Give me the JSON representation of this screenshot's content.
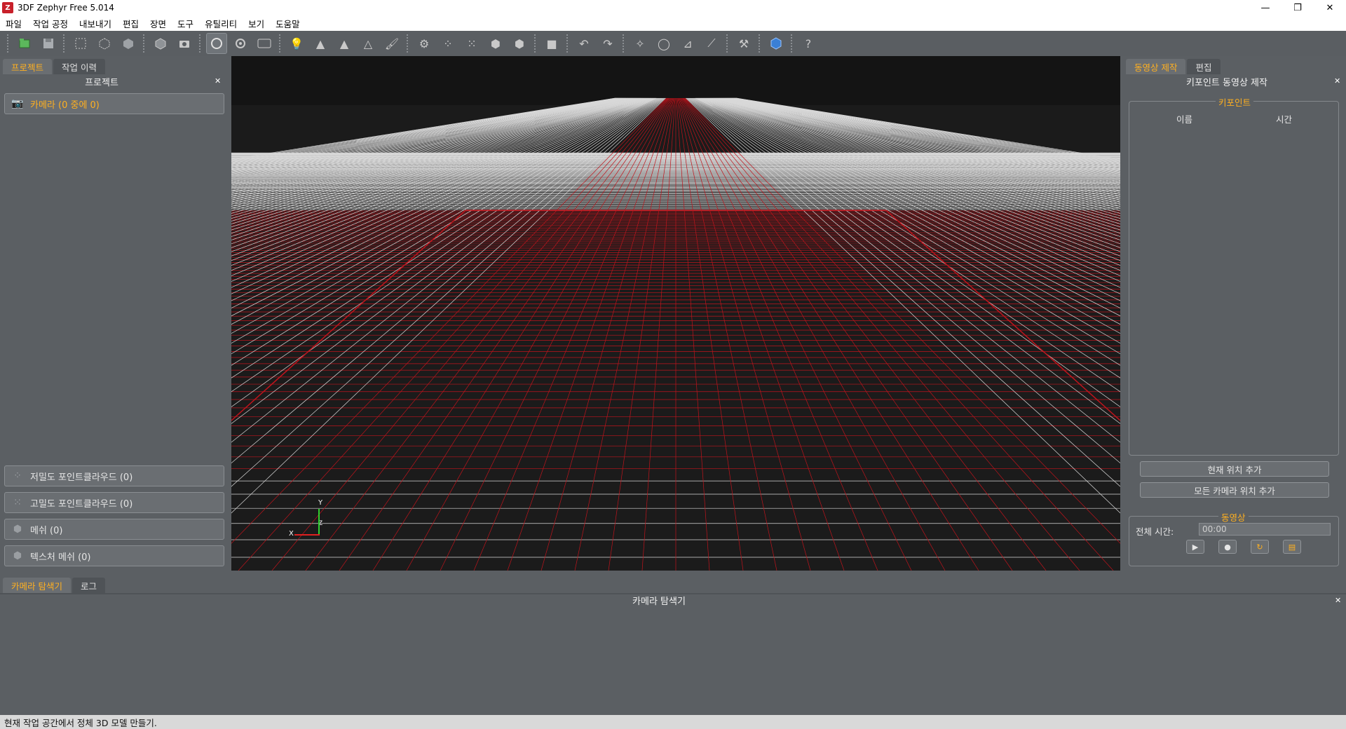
{
  "window": {
    "title": "3DF Zephyr Free 5.014",
    "minimize": "—",
    "restore": "❐",
    "close": "✕"
  },
  "menu": [
    "파일",
    "작업 공정",
    "내보내기",
    "편집",
    "장면",
    "도구",
    "유틸리티",
    "보기",
    "도움말"
  ],
  "left": {
    "tabs": [
      "프로젝트",
      "작업 이력"
    ],
    "panel_title": "프로젝트",
    "cameras": "카메라 (0 중에 0)",
    "sparse": "저밀도 포인트클라우드 (0)",
    "dense": "고밀도 포인트클라우드 (0)",
    "mesh": "메쉬 (0)",
    "textured": "텍스처 메쉬 (0)"
  },
  "right": {
    "tabs": [
      "동영상 제작",
      "편집"
    ],
    "panel_title": "키포인트 동영상 제작",
    "keypoints_group": "키포인트",
    "col_name": "이름",
    "col_time": "시간",
    "add_current": "현재 위치 추가",
    "add_all": "모든 카메라 위치 추가",
    "video_group": "동영상",
    "total_time_label": "전체 시간:",
    "total_time_value": "00:00"
  },
  "bottom": {
    "tabs": [
      "카메라 탐색기",
      "로그"
    ],
    "panel_title": "카메라 탐색기"
  },
  "viewport": {
    "axis_x": "X",
    "axis_y": "Y",
    "axis_z": "Z"
  },
  "status": "현재 작업 공간에서 정체 3D 모델 만들기.",
  "colors": {
    "accent": "#ffb020",
    "grid_red": "#c0141c",
    "grid_white": "#d8d8d8",
    "viewport_bg": "#1b1b1b"
  }
}
